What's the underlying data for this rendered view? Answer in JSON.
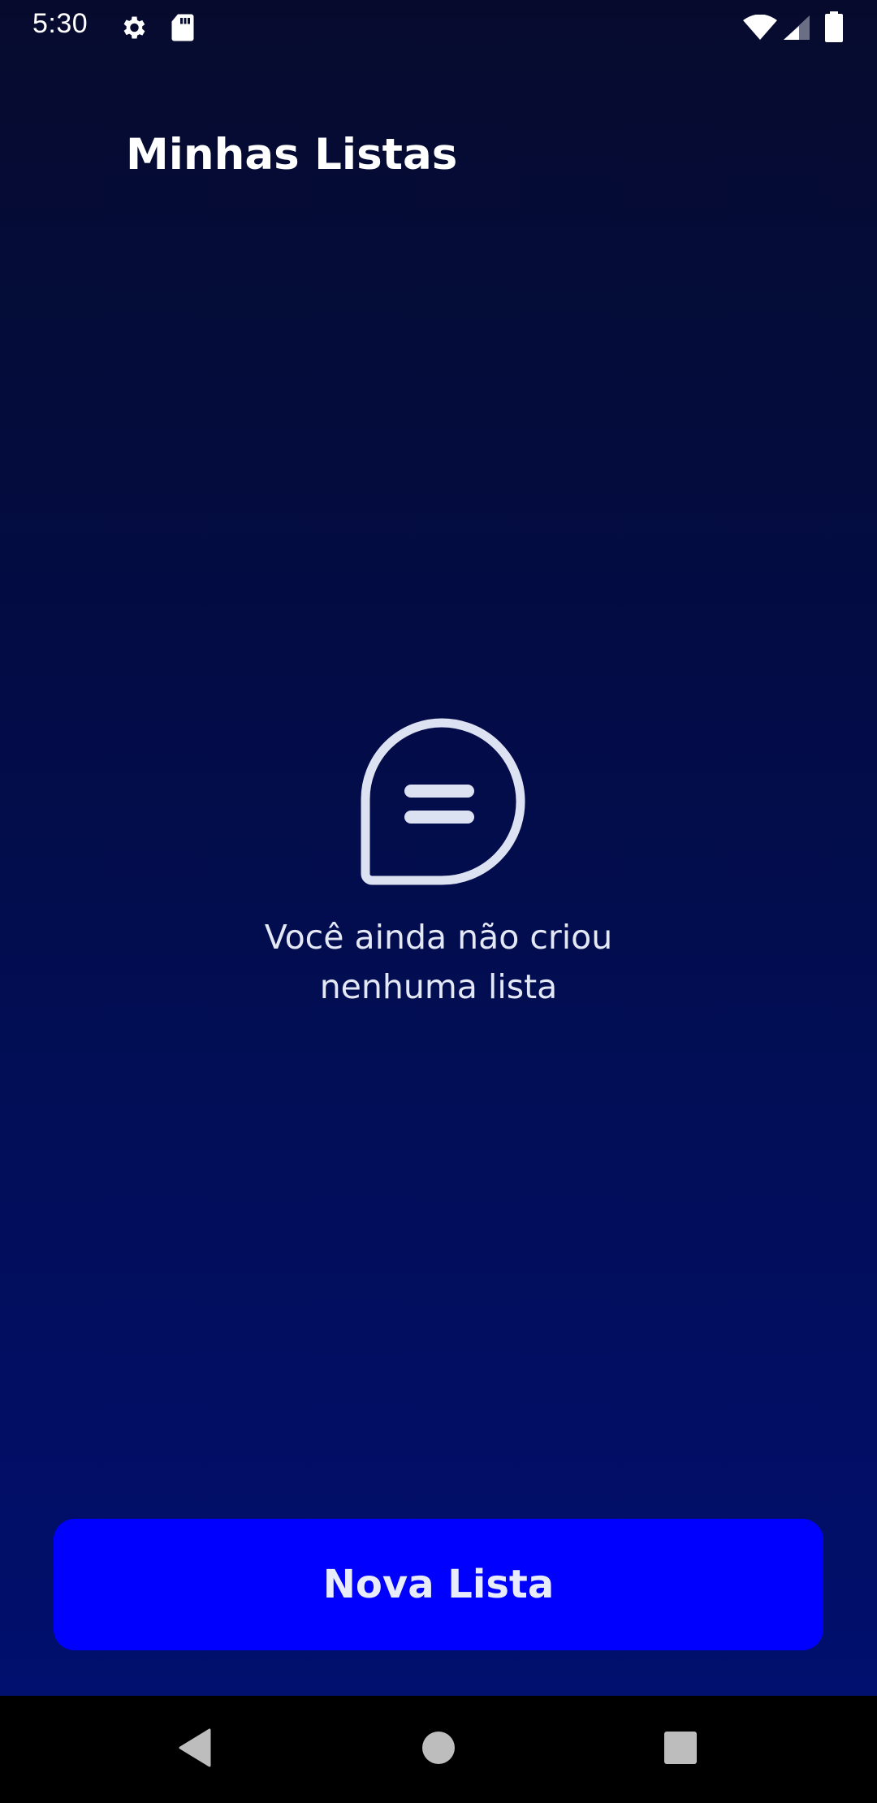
{
  "status_bar": {
    "time": "5:30",
    "icons": [
      "settings-icon",
      "sd-card-icon",
      "wifi-icon",
      "signal-icon",
      "battery-icon"
    ]
  },
  "header": {
    "title": "Minhas Listas"
  },
  "empty_state": {
    "icon": "chat-bubble-icon",
    "line1": "Você ainda não criou",
    "line2": "nenhuma lista"
  },
  "actions": {
    "new_list_label": "Nova Lista"
  },
  "navigation": {
    "buttons": [
      "back-icon",
      "home-icon",
      "recents-icon"
    ]
  },
  "colors": {
    "background_top": "#060b2e",
    "background_bottom": "#010f6e",
    "primary_button": "#0000ff",
    "text": "#ffffff",
    "muted_text": "#e4e8f5"
  }
}
